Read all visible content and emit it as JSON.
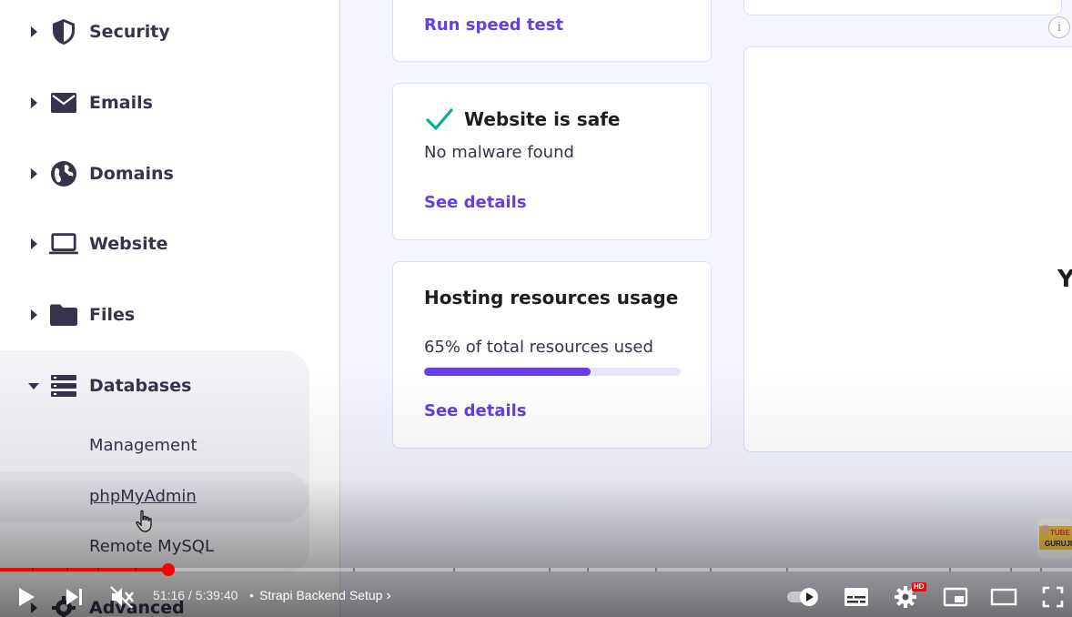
{
  "sidebar": {
    "items": [
      {
        "label": "Security",
        "icon": "shield-icon"
      },
      {
        "label": "Emails",
        "icon": "mail-icon"
      },
      {
        "label": "Domains",
        "icon": "globe-icon"
      },
      {
        "label": "Website",
        "icon": "laptop-icon"
      },
      {
        "label": "Files",
        "icon": "folder-icon"
      },
      {
        "label": "Databases",
        "icon": "database-icon",
        "expanded": true
      },
      {
        "label": "Advanced",
        "icon": "gear-icon"
      }
    ],
    "databases_sub": [
      "Management",
      "phpMyAdmin",
      "Remote MySQL"
    ]
  },
  "speed_card": {
    "link": "Run speed test"
  },
  "safety_card": {
    "title": "Website is safe",
    "text": "No malware found",
    "link": "See details",
    "icon": "check-icon"
  },
  "resources_card": {
    "title": "Hosting resources usage",
    "text": "65% of total resources used",
    "progress": 0.65,
    "link": "See details"
  },
  "right_panel": {
    "cut_text": "Y",
    "info_icon": "i"
  },
  "player": {
    "time": "51:16 / 5:39:40",
    "separator": "•",
    "chapter": "Strapi Backend Setup",
    "played_fraction": 0.157,
    "hd_badge": "HD",
    "channel_logo": "TUBE GURUJI"
  },
  "colors": {
    "accent": "#673de6",
    "success": "#00b090",
    "youtube_red": "#ff0000",
    "progress_track": "#ebe4ff"
  }
}
